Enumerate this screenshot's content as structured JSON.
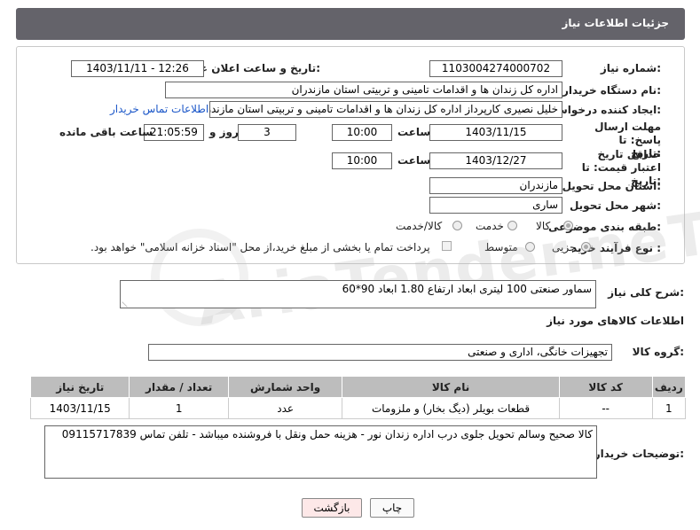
{
  "header": {
    "title": "جزئیات اطلاعات نیاز"
  },
  "form": {
    "need_number_label": "شماره نیاز:",
    "need_number": "1103004274000702",
    "announce_label": "تاریخ و ساعت اعلان عمومی:",
    "announce_value": "1403/11/11 - 12:26",
    "buyer_org_label": "نام دستگاه خریدار:",
    "buyer_org": "اداره کل زندان ها و اقدامات تامینی و تربیتی استان مازندران",
    "requester_label": "ایجاد کننده درخواست:",
    "requester": "خلیل  نصیری کارپرداز اداره کل زندان ها و اقدامات تامینی و تربیتی استان مازندران",
    "buyer_contact_link": "اطلاعات تماس خریدار",
    "reply_deadline_label": "مهلت ارسال پاسخ: تا تاریخ:",
    "reply_date": "1403/11/15",
    "time_label": "ساعت",
    "reply_time": "10:00",
    "days_value": "3",
    "days_label": "روز و",
    "remaining_time": "21:05:59",
    "remaining_label": "ساعت باقی مانده",
    "price_validity_label": "حداقل تاریخ اعتبار قیمت: تا تاریخ:",
    "price_date": "1403/12/27",
    "price_time": "10:00",
    "province_label": "استان محل تحویل:",
    "province": "مازندران",
    "city_label": "شهر محل تحویل:",
    "city": "ساری",
    "category_label": "طبقه بندی موضوعی:",
    "category_options": [
      "کالا",
      "خدمت",
      "کالا/خدمت"
    ],
    "process_label": "نوع فرآیند خرید :",
    "process_options": [
      "جزیی",
      "متوسط"
    ],
    "payment_note": "پرداخت تمام یا بخشی از مبلغ خرید،از محل \"اسناد خزانه اسلامی\" خواهد بود."
  },
  "description": {
    "label": "شرح کلی نیاز:",
    "text": "سماور صنعتی 100 لیتری  ابعاد  ارتفاع 1.80  ابعاد 90*60"
  },
  "goods_section": {
    "title": "اطلاعات کالاهای مورد نیاز",
    "group_label": "گروه کالا:",
    "group_value": "تجهیزات خانگی، اداری و صنعتی"
  },
  "table": {
    "headers": [
      "ردیف",
      "کد کالا",
      "نام کالا",
      "واحد شمارش",
      "تعداد / مقدار",
      "تاریخ نیاز"
    ],
    "rows": [
      [
        "1",
        "--",
        "قطعات بویلر (دیگ بخار) و ملزومات",
        "عدد",
        "1",
        "1403/11/15"
      ]
    ]
  },
  "buyer_notes": {
    "label": "توضیحات خریدار:",
    "text": "کالا صحیح وسالم تحویل جلوی درب اداره زندان نور - هزینه حمل ونقل با فروشنده میباشد - تلفن تماس 09115717839"
  },
  "buttons": {
    "print": "چاپ",
    "back": "بازگشت"
  },
  "colors": {
    "header_bg": "#64636a",
    "link": "#1a56c8",
    "table_header": "#bdbdbd",
    "back_button": "#fde8e8"
  }
}
